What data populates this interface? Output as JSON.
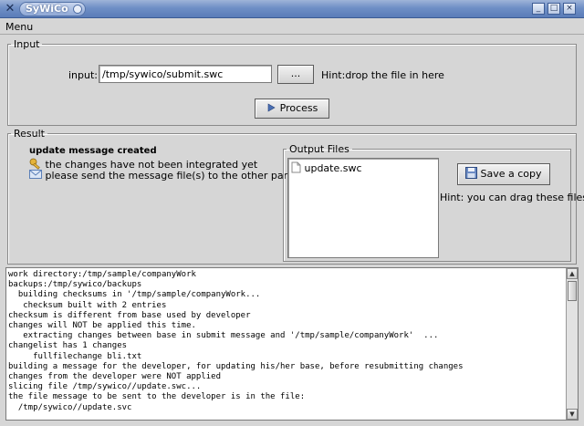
{
  "window": {
    "title": "SyWiCo",
    "system_icon": "x-close-icon",
    "buttons": {
      "minimize": "_",
      "maximize": "□",
      "close": "×"
    }
  },
  "menubar": {
    "menu_label": "Menu"
  },
  "input_group": {
    "legend": "Input",
    "field_label": "input:",
    "field_value": "/tmp/sywico/submit.swc",
    "browse_label": "...",
    "hint": "Hint:drop the file in here",
    "process_label": "Process"
  },
  "result_group": {
    "legend": "Result",
    "status_title": "update message created",
    "messages": [
      {
        "icon": "key-icon",
        "text": "the changes have not been integrated yet"
      },
      {
        "icon": "envelope-icon",
        "text": "please send the message file(s) to the other party"
      }
    ],
    "output_files": {
      "legend": "Output Files",
      "files": [
        "update.swc"
      ]
    },
    "save_label": "Save a copy",
    "drag_hint": "Hint: you can drag these files"
  },
  "log_lines": [
    "work directory:/tmp/sample/companyWork",
    "backups:/tmp/sywico/backups",
    "  building checksums in '/tmp/sample/companyWork...",
    "   checksum built with 2 entries",
    "checksum is different from base used by developer",
    "changes will NOT be applied this time.",
    "",
    "   extracting changes between base in submit message and '/tmp/sample/companyWork'  ...",
    "changelist has 1 changes",
    "     fullfilechange bli.txt",
    "building a message for the developer, for updating his/her base, before resubmitting changes",
    "changes from the developer were NOT applied",
    "slicing file /tmp/sywico//update.swc...",
    "the file message to be sent to the developer is in the file:",
    "  /tmp/sywico//update.svc"
  ]
}
